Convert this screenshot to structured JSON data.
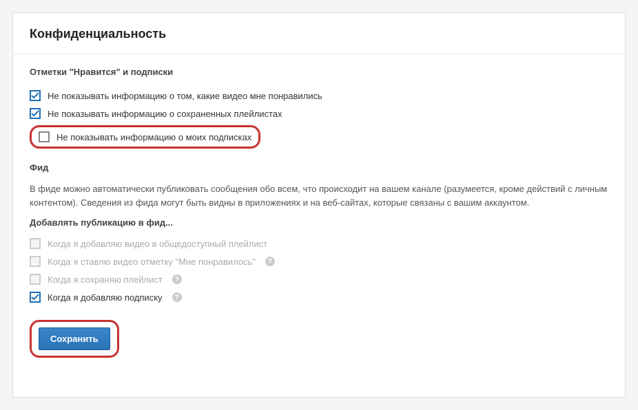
{
  "header": {
    "title": "Конфиденциальность"
  },
  "section1": {
    "title": "Отметки \"Нравится\" и подписки",
    "items": [
      {
        "label": "Не показывать информацию о том, какие видео мне понравились",
        "checked": true
      },
      {
        "label": "Не показывать информацию о сохраненных плейлистах",
        "checked": true
      },
      {
        "label": "Не показывать информацию о моих подписках",
        "checked": false
      }
    ]
  },
  "section2": {
    "title": "Фид",
    "description": "В фиде можно автоматически публиковать сообщения обо всем, что происходит на вашем канале (разумеется, кроме действий с личным контентом). Сведения из фида могут быть видны в приложениях и на веб-сайтах, которые связаны с вашим аккаунтом.",
    "subheading": "Добавлять публикацию в фид...",
    "items": [
      {
        "label": "Когда я добавляю видео в общедоступный плейлист",
        "checked": false,
        "disabled": true,
        "help": false
      },
      {
        "label": "Когда я ставлю видео отметку \"Мне понравилось\"",
        "checked": false,
        "disabled": true,
        "help": true
      },
      {
        "label": "Когда я сохраняю плейлист",
        "checked": false,
        "disabled": true,
        "help": true
      },
      {
        "label": "Когда я добавляю подписку",
        "checked": true,
        "disabled": false,
        "help": true
      }
    ]
  },
  "actions": {
    "save": "Сохранить"
  },
  "glyphs": {
    "help": "?"
  }
}
